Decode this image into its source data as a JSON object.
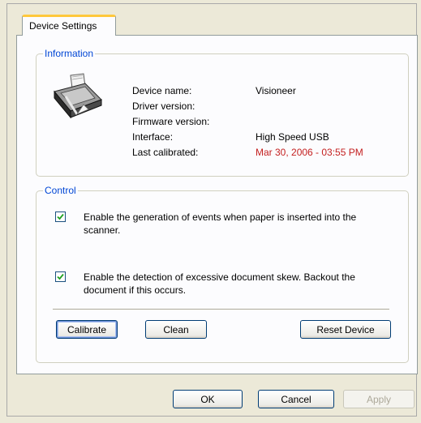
{
  "tab": {
    "label": "Device Settings"
  },
  "information": {
    "legend": "Information",
    "icon": "scanner-icon",
    "rows": [
      {
        "label": "Device name:",
        "value": "Visioneer"
      },
      {
        "label": "Driver version:",
        "value": ""
      },
      {
        "label": "Firmware version:",
        "value": ""
      },
      {
        "label": "Interface:",
        "value": "High Speed USB"
      },
      {
        "label": "Last calibrated:",
        "value": "Mar 30, 2006 - 03:55 PM"
      }
    ],
    "highlight_color": "#c42020"
  },
  "control": {
    "legend": "Control",
    "checkboxes": [
      {
        "label": "Enable the generation of events when paper is inserted into the scanner.",
        "checked": true
      },
      {
        "label": "Enable the detection of excessive document skew. Backout the document if this occurs.",
        "checked": true
      }
    ],
    "buttons": {
      "calibrate": "Calibrate",
      "clean": "Clean",
      "reset": "Reset Device"
    }
  },
  "footer": {
    "ok": "OK",
    "cancel": "Cancel",
    "apply": "Apply"
  },
  "colors": {
    "legend": "#0046d5",
    "check": "#21a121",
    "tab_accent": "#ffc83c"
  }
}
